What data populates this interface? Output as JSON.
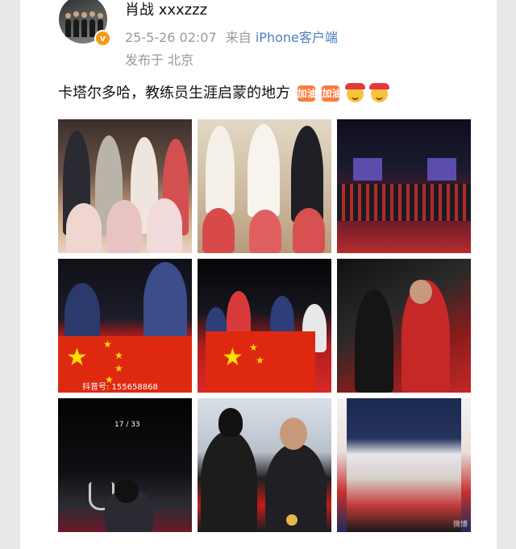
{
  "user": {
    "name": "肖战 xxxzzz",
    "verified_badge": "v",
    "avatar_icon": "avatar-icon"
  },
  "meta": {
    "datetime": "25-5-26 02:07",
    "source_prefix": "来自",
    "source": "iPhone客户端",
    "location": "发布于 北京"
  },
  "post": {
    "text": "卡塔尔多哈，教练员生涯启蒙的地方",
    "emojis": [
      "加油",
      "加油",
      "face-cheer",
      "face-cheer"
    ],
    "emoji_labels": [
      "加油",
      "加油"
    ]
  },
  "images": {
    "img3_overlay": "抖音号: 155658868",
    "img7_counter": "17 / 33",
    "img9_watermark": "微博"
  },
  "colors": {
    "link": "#4a7fc1",
    "meta": "#9a9a9a",
    "flag_red": "#de2910",
    "flag_yellow": "#ffde00"
  }
}
